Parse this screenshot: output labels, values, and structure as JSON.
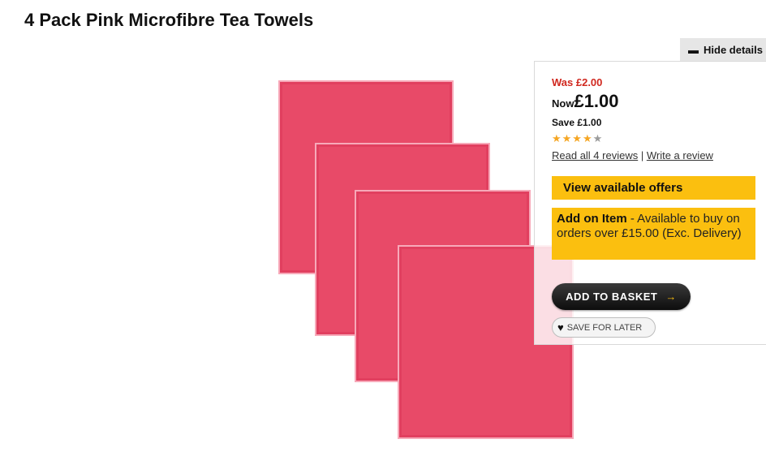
{
  "product": {
    "title": "4 Pack Pink Microfibre Tea Towels",
    "image_alt": "pink-tea-towels-stack",
    "towel_color": "#e84a68"
  },
  "details_toggle": {
    "label": "Hide details",
    "icon": "minus-icon"
  },
  "pricing": {
    "was": "Was £2.00",
    "now_label": "Now",
    "now_price": "£1.00",
    "save": "Save £1.00"
  },
  "rating": {
    "stars_full": "★★★★",
    "stars_half": "★",
    "value": 4.5,
    "max": 5,
    "color": "#f5a623"
  },
  "reviews": {
    "read_link": "Read all 4 reviews",
    "separator": " | ",
    "write_link": "Write a review"
  },
  "offers": {
    "label": "View available offers",
    "color": "#fbbf0f"
  },
  "addon": {
    "title": "Add on Item",
    "text": " - Available to buy on orders over £15.00 (Exc. Delivery)"
  },
  "actions": {
    "add_to_basket": "ADD TO BASKET",
    "add_to_basket_icon": "arrow-right-icon",
    "save_for_later": "SAVE FOR LATER",
    "save_for_later_icon": "heart-icon"
  }
}
